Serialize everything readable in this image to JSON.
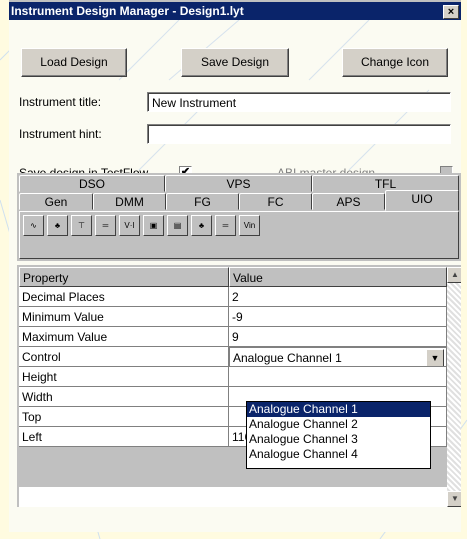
{
  "window": {
    "title": "Instrument Design Manager - Design1.lyt",
    "close_glyph": "×"
  },
  "toolbar": {
    "load_label": "Load Design",
    "save_label": "Save Design",
    "change_icon_label": "Change Icon"
  },
  "form": {
    "title_label": "Instrument title:",
    "title_value": "New Instrument",
    "hint_label": "Instrument hint:",
    "hint_value": "",
    "save_testflow_label": "Save design in TestFlow",
    "save_testflow_checked": "✔",
    "abi_master_label": "ABI master design"
  },
  "tabs": {
    "row1": [
      "DSO",
      "VPS",
      "TFL"
    ],
    "row2": [
      "Gen",
      "DMM",
      "FG",
      "FC",
      "APS",
      "UIO"
    ],
    "active": "UIO"
  },
  "palette_icons": [
    "sine-source-icon",
    "probe-red-icon",
    "probe-yellow-icon",
    "digital-red-icon",
    "voltmeter-icon",
    "meter-green-icon",
    "meter-yellow-icon",
    "probe-red-icon-2",
    "digital-blue-icon",
    "vin-icon"
  ],
  "palette_labels": [
    "∿",
    "♣",
    "⊤",
    "═",
    "V·I",
    "▣",
    "▤",
    "♣",
    "═",
    "Vin"
  ],
  "grid": {
    "headers": [
      "Property",
      "Value"
    ],
    "rows": [
      [
        "Decimal Places",
        "2"
      ],
      [
        "Minimum Value",
        "-9"
      ],
      [
        "Maximum Value",
        "9"
      ],
      [
        "Control",
        "Analogue Channel 1"
      ],
      [
        "Height",
        ""
      ],
      [
        "Width",
        ""
      ],
      [
        "Top",
        ""
      ],
      [
        "Left",
        "116"
      ]
    ]
  },
  "dropdown": {
    "options": [
      "Analogue Channel 1",
      "Analogue Channel 2",
      "Analogue Channel 3",
      "Analogue Channel 4"
    ],
    "selected": "Analogue Channel 1"
  }
}
